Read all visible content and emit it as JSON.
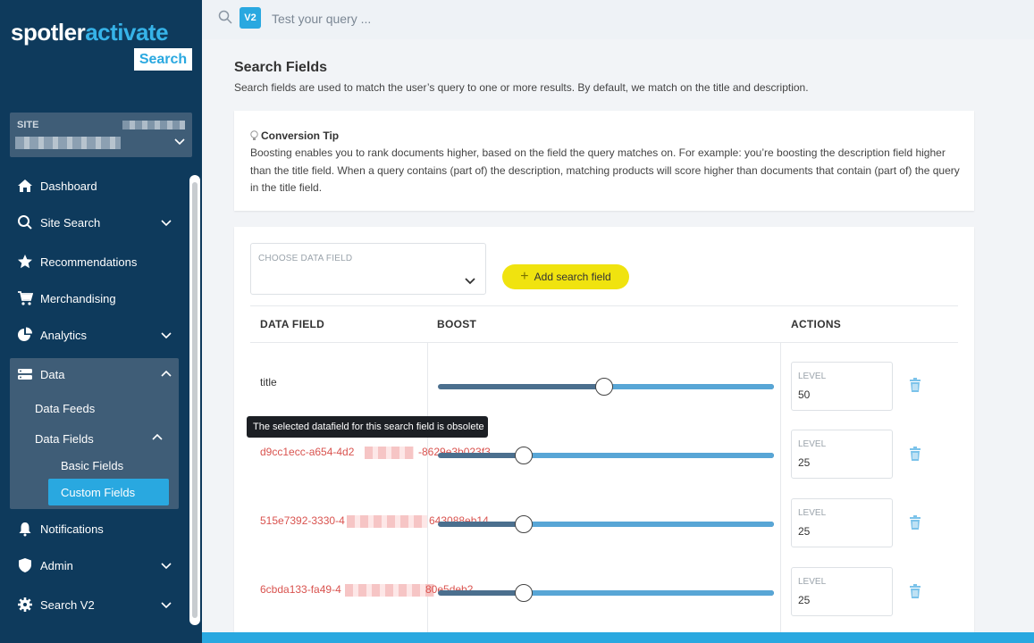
{
  "brand": {
    "logo_white": "spotler",
    "logo_blue": "activate",
    "badge": "Search"
  },
  "site": {
    "label": "SITE"
  },
  "nav": {
    "dashboard": "Dashboard",
    "site_search": "Site Search",
    "recommendations": "Recommendations",
    "merchandising": "Merchandising",
    "analytics": "Analytics",
    "data": "Data",
    "data_feeds": "Data Feeds",
    "data_fields": "Data Fields",
    "basic_fields": "Basic Fields",
    "custom_fields": "Custom Fields",
    "notifications": "Notifications",
    "admin": "Admin",
    "search_v2": "Search V2"
  },
  "topbar": {
    "version_badge": "V2",
    "query_placeholder": "Test your query ..."
  },
  "page": {
    "title": "Search Fields",
    "description": "Search fields are used to match the user’s query to one or more results. By default, we match on the title and description."
  },
  "tip": {
    "title": "Conversion Tip",
    "body": "Boosting enables you to rank documents higher, based on the field the query matches on. For example: you’re boosting the description field higher than the title field. When a query contains (part of) the description, matching products will score higher than documents that contain (part of) the query in the title field."
  },
  "controls": {
    "choose_label": "CHOOSE DATA FIELD",
    "add_button": "Add search field"
  },
  "table": {
    "headers": {
      "data_field": "DATA FIELD",
      "boost": "BOOST",
      "actions": "ACTIONS"
    },
    "level_label": "LEVEL",
    "rows": [
      {
        "name": "title",
        "level": "50",
        "obsolete": false
      },
      {
        "name": "d9cc1ecc-a654-4d2",
        "name_end": "-8629e3b023f3",
        "level": "25",
        "obsolete": true
      },
      {
        "name": "515e7392-3330-4",
        "name_end": "643088eb14",
        "level": "25",
        "obsolete": true
      },
      {
        "name": "6cbda133-fa49-4",
        "name_end": "80e5deb2",
        "level": "25",
        "obsolete": true
      }
    ]
  },
  "tooltip": "The selected datafield for this search field is obsolete",
  "colors": {
    "sidebar": "#0e3a5c",
    "accent": "#29a8e0",
    "button": "#f0e30f",
    "obsolete": "#d9534f"
  }
}
